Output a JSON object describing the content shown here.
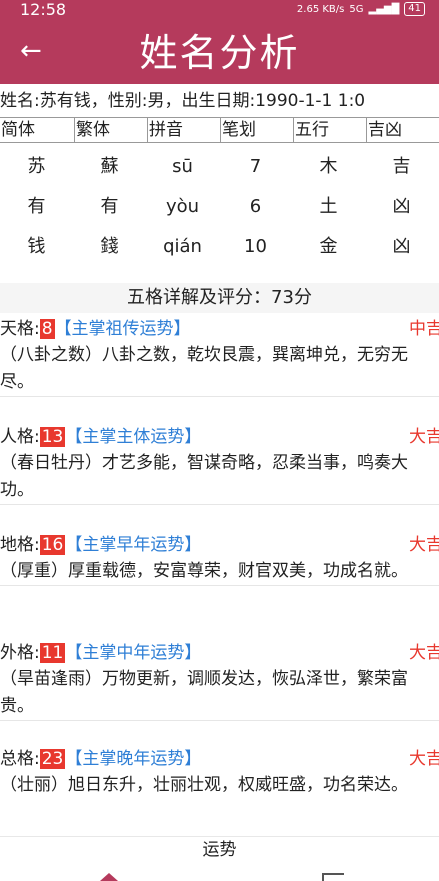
{
  "status_bar": {
    "time": "12:58",
    "net_speed": "2.65 KB/s",
    "network": "5G",
    "battery": "41"
  },
  "header": {
    "title": "姓名分析"
  },
  "info_line": "姓名:苏有钱，性别:男，出生日期:1990-1-1 1:0",
  "table": {
    "columns": [
      "简体",
      "繁体",
      "拼音",
      "笔划",
      "五行",
      "吉凶"
    ],
    "rows": [
      [
        "苏",
        "蘇",
        "sū",
        "7",
        "木",
        "吉"
      ],
      [
        "有",
        "有",
        "yòu",
        "6",
        "土",
        "凶"
      ],
      [
        "钱",
        "錢",
        "qián",
        "10",
        "金",
        "凶"
      ]
    ]
  },
  "section_title": "五格详解及评分：73分",
  "wuge": [
    {
      "name": "天格:",
      "num": "8",
      "rule": "【主掌祖传运势】",
      "luck": "中吉",
      "desc": "（八卦之数）八卦之数，乾坎艮震，巽离坤兑，无穷无尽。"
    },
    {
      "name": "人格:",
      "num": "13",
      "rule": "【主掌主体运势】",
      "luck": "大吉",
      "desc": "（春日牡丹）才艺多能，智谋奇略，忍柔当事，鸣奏大功。"
    },
    {
      "name": "地格:",
      "num": "16",
      "rule": "【主掌早年运势】",
      "luck": "大吉",
      "desc": "（厚重）厚重载德，安富尊荣，财官双美，功成名就。"
    },
    {
      "name": "外格:",
      "num": "11",
      "rule": "【主掌中年运势】",
      "luck": "大吉",
      "desc": "（旱苗逢雨）万物更新，调顺发达，恢弘泽世，繁荣富贵。"
    },
    {
      "name": "总格:",
      "num": "23",
      "rule": "【主掌晚年运势】",
      "luck": "大吉",
      "desc": "（壮丽）旭日东升，壮丽壮观，权威旺盛，功名荣达。"
    }
  ],
  "bottom": {
    "label": "运势"
  }
}
